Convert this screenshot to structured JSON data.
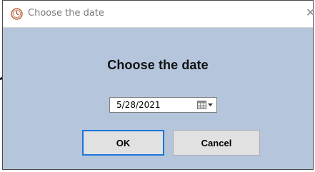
{
  "window": {
    "title": "Choose the date",
    "heading": "Choose the date"
  },
  "date_picker": {
    "value": "5/28/2021",
    "icon": "calendar-icon"
  },
  "buttons": {
    "ok": "OK",
    "cancel": "Cancel"
  },
  "colors": {
    "dialog_background": "#b4c5dc",
    "titlebar": "#ffffff",
    "focus_border": "#1e74d8"
  }
}
